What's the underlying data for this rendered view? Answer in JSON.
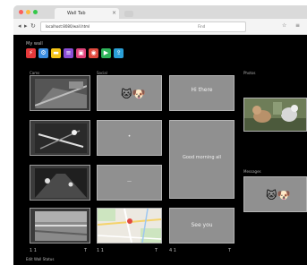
{
  "browser": {
    "tab_title": "Wall Tab",
    "tab_close": "×",
    "url": "localhost:8080/wall.html",
    "find_text": "Find",
    "nav": {
      "back": "◂",
      "forward": "▸",
      "reload": "↻"
    },
    "toolbar": {
      "star": "☆",
      "menu": "≡"
    },
    "traffic_lights": [
      "#fc605b",
      "#fdbc40",
      "#34c84a"
    ]
  },
  "app": {
    "title": "My wall",
    "icons": [
      {
        "icon": "bolt-icon",
        "glyph": "⚡",
        "color": "#e5393b"
      },
      {
        "icon": "gear-icon",
        "glyph": "⚙",
        "color": "#3d8ee0"
      },
      {
        "icon": "folder-icon",
        "glyph": "▬",
        "color": "#f5c518"
      },
      {
        "icon": "list-icon",
        "glyph": "≡",
        "color": "#8a4fd6"
      },
      {
        "icon": "slides-icon",
        "glyph": "▣",
        "color": "#e0437a"
      },
      {
        "icon": "globe-icon",
        "glyph": "◉",
        "color": "#e04a3f"
      },
      {
        "icon": "video-icon",
        "glyph": "▶",
        "color": "#2fb45a"
      },
      {
        "icon": "share-icon",
        "glyph": "⇪",
        "color": "#2a9fd6"
      }
    ]
  },
  "columns": {
    "col1_title": "Cams",
    "col2_title": "Social",
    "col4_title": "Photos",
    "col4_sub": "Messages"
  },
  "tiles": {
    "col2": {
      "snap": "🐱🐶",
      "dot": "•",
      "dash": "—"
    },
    "col3": {
      "top_text": "Hi there",
      "middle_text": "Good morning all",
      "bottom_text": "See you"
    },
    "col4": {
      "snap": "🐱🐶",
      "photo_alt": "Pets"
    }
  },
  "footers": {
    "col1": [
      "1 1",
      "T"
    ],
    "col2": [
      "1 1",
      "T"
    ],
    "col3": [
      "4 1",
      "T"
    ],
    "bottom_left": "Edit Wall Status"
  }
}
